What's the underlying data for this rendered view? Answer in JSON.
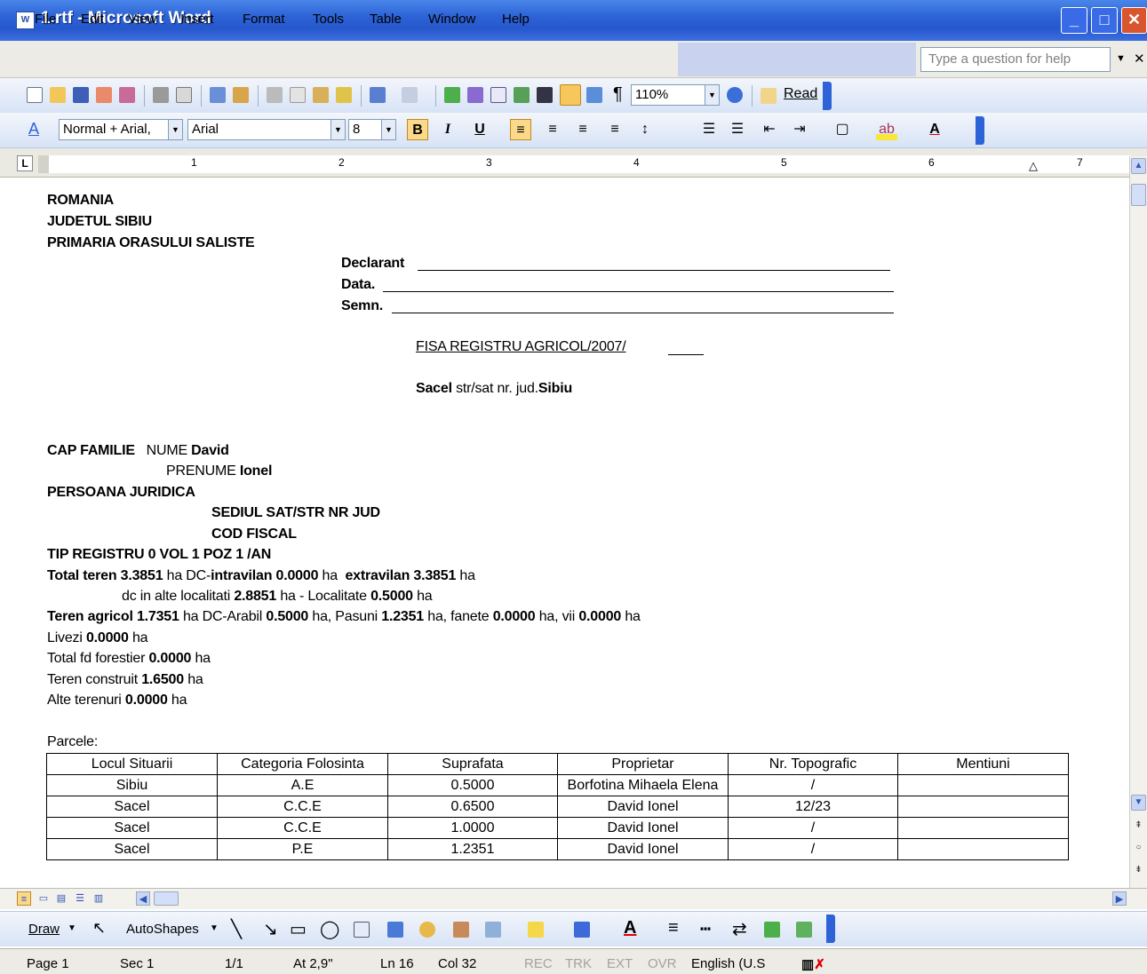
{
  "window": {
    "title": "1.rtf - Microsoft Word",
    "icon": "word-doc-icon",
    "buttons": [
      "minimize",
      "maximize",
      "close"
    ]
  },
  "menu": {
    "items": [
      "File",
      "Edit",
      "View",
      "Insert",
      "Format",
      "Tools",
      "Table",
      "Window",
      "Help"
    ],
    "help_placeholder": "Type a question for help"
  },
  "standard_toolbar": {
    "zoom": "110%",
    "read_label": "Read"
  },
  "formatting_toolbar": {
    "style": "Normal + Arial,",
    "font": "Arial",
    "size": "8"
  },
  "ruler": {
    "numbers": [
      "1",
      "2",
      "3",
      "4",
      "5",
      "6",
      "7"
    ]
  },
  "document": {
    "header_lines": [
      "ROMANIA",
      "JUDETUL SIBIU",
      "PRIMARIA ORASULUI SALISTE"
    ],
    "sign_fields": [
      "Declarant",
      "Data.",
      "Semn."
    ],
    "form_title": "FISA REGISTRU AGRICOL/2007/",
    "location": {
      "village": "Sacel",
      "mid": "str/sat  nr. jud.",
      "county": "Sibiu"
    },
    "cap_familie": {
      "label": "CAP FAMILIE",
      "nume_label": "NUME",
      "nume": "David",
      "prenume_label": "PRENUME",
      "prenume": "Ionel"
    },
    "persoana_juridica": "PERSOANA JURIDICA",
    "sediul": "SEDIUL  SAT/STR  NR  JUD",
    "cod_fiscal": "COD FISCAL",
    "tip_registru": "TIP REGISTRU 0 VOL 1 POZ  1 /AN",
    "total_teren": {
      "label": "Total teren",
      "value": "3.3851",
      "dc_label": "ha DC-",
      "intravilan_label": "intravilan",
      "intravilan": "0.0000",
      "extravilan_label": "extravilan",
      "extravilan": "3.3851",
      "unit": "ha"
    },
    "dc_alte": {
      "prefix": "dc in alte localitati",
      "value": "2.8851",
      "mid": "ha - Localitate",
      "loc_value": "0.5000",
      "unit": "ha"
    },
    "teren_agricol": {
      "label": "Teren agricol",
      "value": "1.7351",
      "arabil_label": "ha DC-Arabil",
      "arabil": "0.5000",
      "pasuni_label": "ha, Pasuni",
      "pasuni": "1.2351",
      "fanete_label": "ha, fanete",
      "fanete": "0.0000",
      "vii_label": "ha, vii",
      "vii": "0.0000",
      "unit": "ha"
    },
    "livezi": {
      "label": "Livezi",
      "value": "0.0000",
      "unit": "ha"
    },
    "forestier": {
      "label": "Total fd forestier",
      "value": "0.0000",
      "unit": "ha"
    },
    "construit": {
      "label": "Teren construit",
      "value": "1.6500",
      "unit": "ha"
    },
    "alte": {
      "label": "Alte terenuri",
      "value": "0.0000",
      "unit": "ha"
    },
    "parcele_label": "Parcele:",
    "table": {
      "headers": [
        "Locul Situarii",
        "Categoria Folosinta",
        "Suprafata",
        "Proprietar",
        "Nr. Topografic",
        "Mentiuni"
      ],
      "rows": [
        [
          "Sibiu",
          "A.E",
          "0.5000",
          "Borfotina Mihaela Elena",
          "/",
          ""
        ],
        [
          "Sacel",
          "C.C.E",
          "0.6500",
          "David Ionel",
          "12/23",
          ""
        ],
        [
          "Sacel",
          "C.C.E",
          "1.0000",
          "David Ionel",
          "/",
          ""
        ],
        [
          "Sacel",
          "P.E",
          "1.2351",
          "David Ionel",
          "/",
          ""
        ]
      ]
    }
  },
  "draw_toolbar": {
    "draw_label": "Draw",
    "autoshapes_label": "AutoShapes"
  },
  "status": {
    "page": "Page 1",
    "sec": "Sec 1",
    "pages": "1/1",
    "at": "At 2,9\"",
    "ln": "Ln 16",
    "col": "Col 32",
    "rec": "REC",
    "trk": "TRK",
    "ext": "EXT",
    "ovr": "OVR",
    "lang": "English (U.S"
  }
}
